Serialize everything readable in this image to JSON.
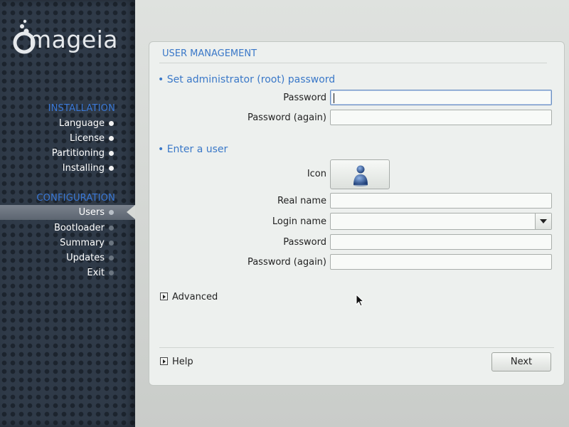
{
  "sidebar": {
    "logo_text": "mageia",
    "installation_title": "INSTALLATION",
    "installation_items": [
      {
        "label": "Language"
      },
      {
        "label": "License"
      },
      {
        "label": "Partitioning"
      },
      {
        "label": "Installing"
      }
    ],
    "configuration_title": "CONFIGURATION",
    "configuration_items": [
      {
        "label": "Users",
        "active": true
      },
      {
        "label": "Bootloader"
      },
      {
        "label": "Summary"
      },
      {
        "label": "Updates"
      },
      {
        "label": "Exit"
      }
    ]
  },
  "panel": {
    "title": "USER MANAGEMENT",
    "root_section": {
      "heading": "• Set administrator (root) password",
      "password_label": "Password",
      "password_value": "",
      "password_again_label": "Password (again)",
      "password_again_value": ""
    },
    "user_section": {
      "heading": "• Enter a user",
      "icon_label": "Icon",
      "icon_name": "user-avatar-icon",
      "real_name_label": "Real name",
      "real_name_value": "",
      "login_name_label": "Login name",
      "login_name_value": "",
      "password_label": "Password",
      "password_value": "",
      "password_again_label": "Password (again)",
      "password_again_value": ""
    },
    "advanced_label": "Advanced",
    "help_label": "Help",
    "next_label": "Next"
  },
  "colors": {
    "accent_blue": "#3a78c8",
    "sidebar_bg": "#2f3a48",
    "panel_bg": "#edf0ee"
  }
}
